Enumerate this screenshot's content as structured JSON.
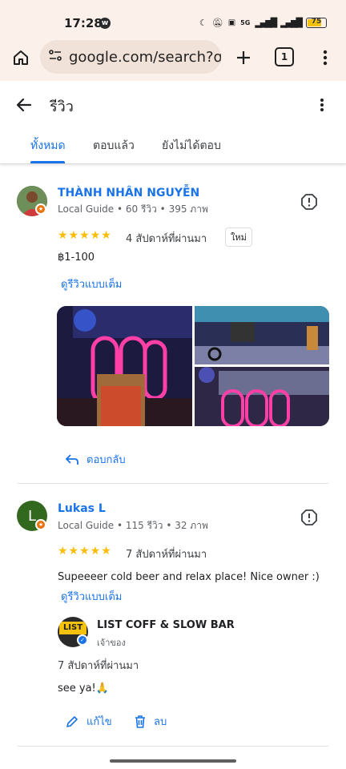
{
  "status_bar": {
    "time": "17:28",
    "network": "5G",
    "battery": "75"
  },
  "browser": {
    "url": "google.com/search?q=l",
    "tab_count": "1"
  },
  "header": {
    "title": "รีวิว"
  },
  "tabs": [
    {
      "label": "ทั้งหมด",
      "active": true
    },
    {
      "label": "ตอบแล้ว",
      "active": false
    },
    {
      "label": "ยังไม่ได้ตอบ",
      "active": false
    }
  ],
  "reviews": [
    {
      "author": "THÀNH NHÂN NGUYỄN",
      "meta": "Local Guide • 60 รีวิว • 395 ภาพ",
      "stars": "★★★★★",
      "rating": 5,
      "when": "4 สัปดาห์ที่ผ่านมา",
      "new_label": "ใหม่",
      "price": "฿1-100",
      "full_review_link": "ดูรีวิวแบบเต็ม",
      "reply_label": "ตอบกลับ"
    },
    {
      "author": "Lukas L",
      "avatar_letter": "L",
      "meta": "Local Guide • 115 รีวิว • 32 ภาพ",
      "stars": "★★★★★",
      "rating": 5,
      "when": "7 สัปดาห์ที่ผ่านมา",
      "text": "Supeeeer cold beer and relax place! Nice owner :)",
      "full_review_link": "ดูรีวิวแบบเต็ม",
      "owner_reply": {
        "name": "LIST COFF & SLOW BAR",
        "role": "เจ้าของ",
        "logo_text": "LIST",
        "when": "7 สัปดาห์ที่ผ่านมา",
        "text": "see ya!🙏"
      },
      "edit_label": "แก้ไข",
      "delete_label": "ลบ"
    }
  ],
  "colors": {
    "accent": "#1a73e8",
    "star": "#fbbc04",
    "chrome_bg": "#fbf1ea"
  }
}
